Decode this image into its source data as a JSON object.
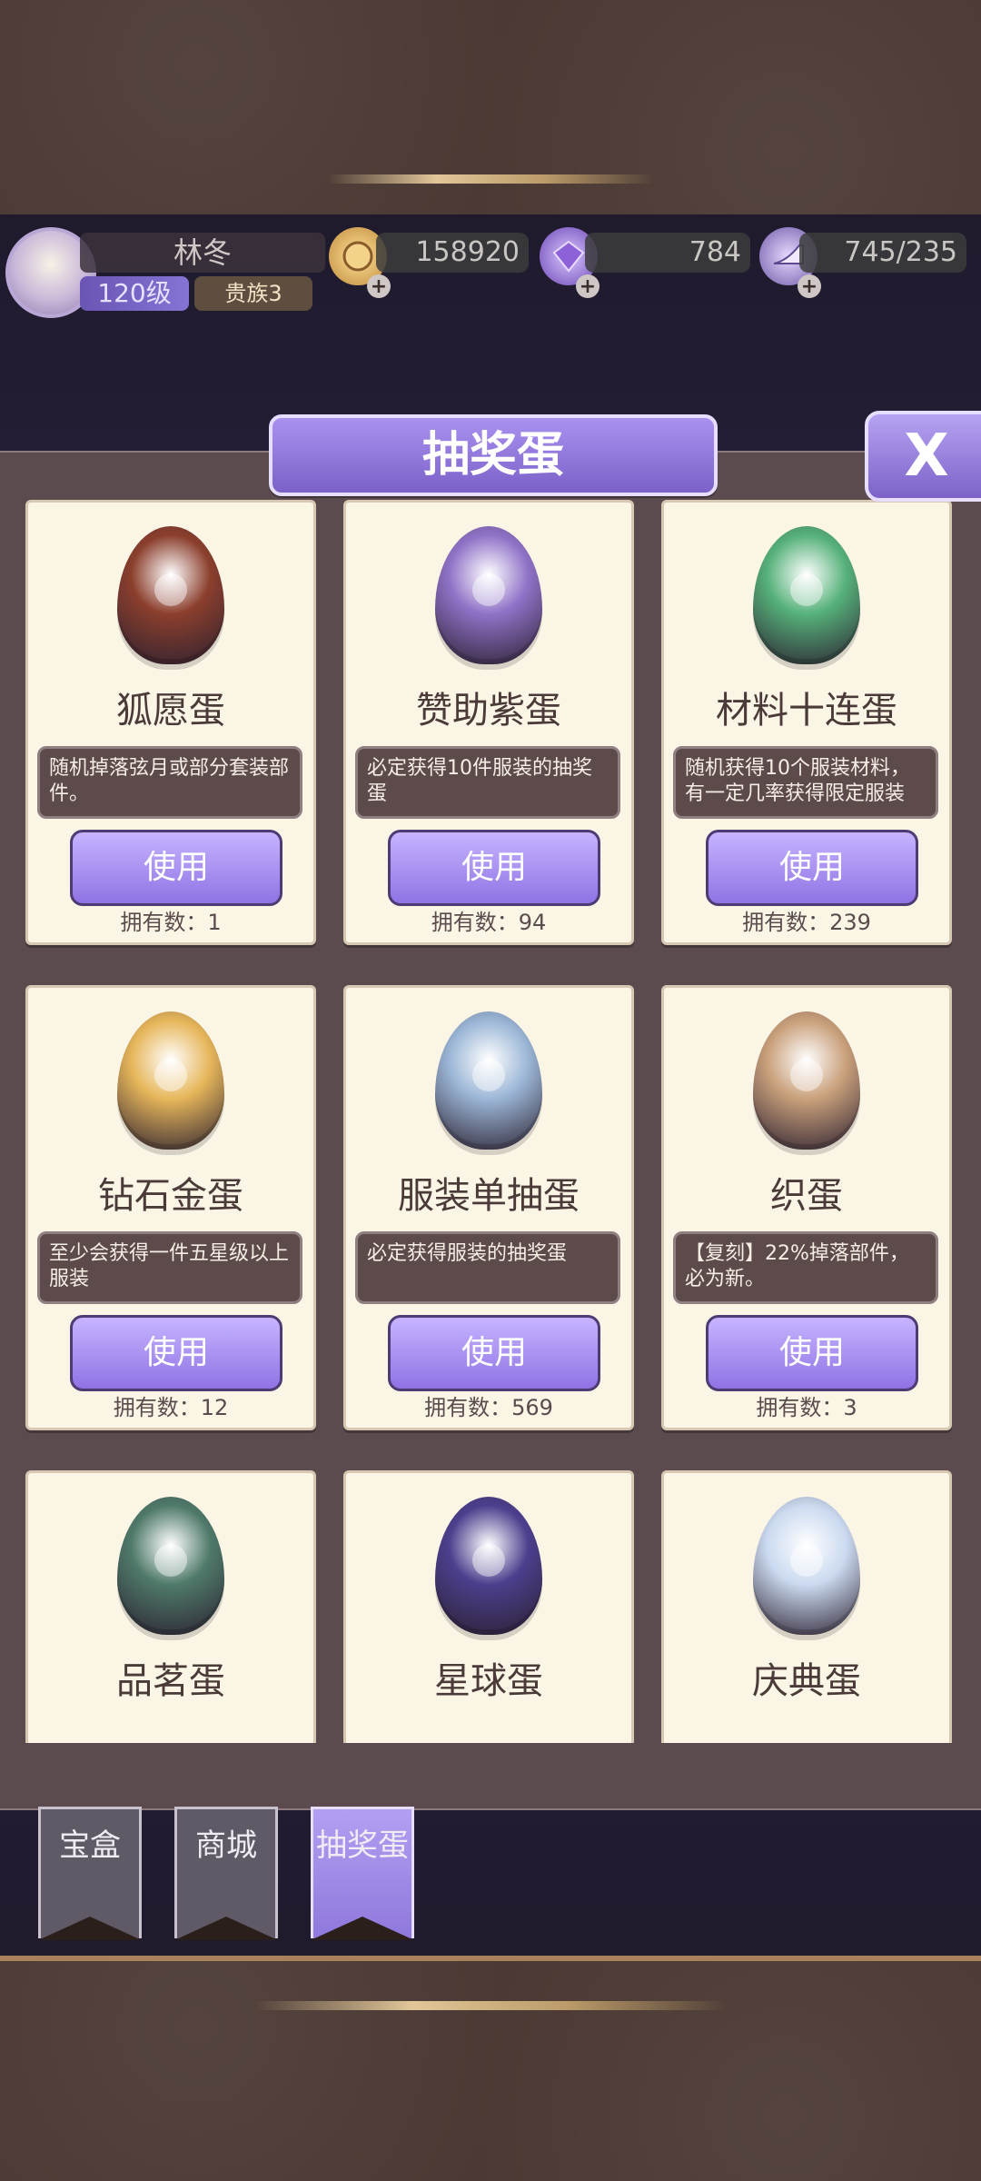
{
  "player": {
    "name": "林冬",
    "level": "120级",
    "rank": "贵族3"
  },
  "currency": {
    "gold": "158920",
    "diamond": "784",
    "energy": "745/235"
  },
  "modal": {
    "title": "抽奖蛋",
    "close_label": "X"
  },
  "eggs": [
    {
      "title": "狐愿蛋",
      "desc": "随机掉落弦月或部分套装部件。",
      "button": "使用",
      "owned": "拥有数：1",
      "color": "#8b3f2d"
    },
    {
      "title": "赞助紫蛋",
      "desc": "必定获得10件服装的抽奖蛋",
      "button": "使用",
      "owned": "拥有数：94",
      "color": "#8f72c7"
    },
    {
      "title": "材料十连蛋",
      "desc": "随机获得10个服装材料，有一定几率获得限定服装",
      "button": "使用",
      "owned": "拥有数：239",
      "color": "#56b17a"
    },
    {
      "title": "钻石金蛋",
      "desc": "至少会获得一件五星级以上服装",
      "button": "使用",
      "owned": "拥有数：12",
      "color": "#e6b65a"
    },
    {
      "title": "服装单抽蛋",
      "desc": "必定获得服装的抽奖蛋",
      "button": "使用",
      "owned": "拥有数：569",
      "color": "#9bb6d6"
    },
    {
      "title": "织蛋",
      "desc": "【复刻】22%掉落部件，必为新。",
      "button": "使用",
      "owned": "拥有数：3",
      "color": "#c9a07b"
    },
    {
      "title": "品茗蛋",
      "desc": "",
      "button": "",
      "owned": "",
      "color": "#4f7a6a"
    },
    {
      "title": "星球蛋",
      "desc": "",
      "button": "",
      "owned": "",
      "color": "#4c3f8d"
    },
    {
      "title": "庆典蛋",
      "desc": "",
      "button": "",
      "owned": "",
      "color": "#cbdaf0"
    }
  ],
  "tabs": {
    "treasure": "宝盒",
    "shop": "商城",
    "eggs": "抽奖蛋"
  },
  "icons": {
    "avatar": "avatar",
    "gold": "gold-coin-icon",
    "diamond": "diamond-icon",
    "energy": "heel-icon",
    "close": "close-icon"
  }
}
